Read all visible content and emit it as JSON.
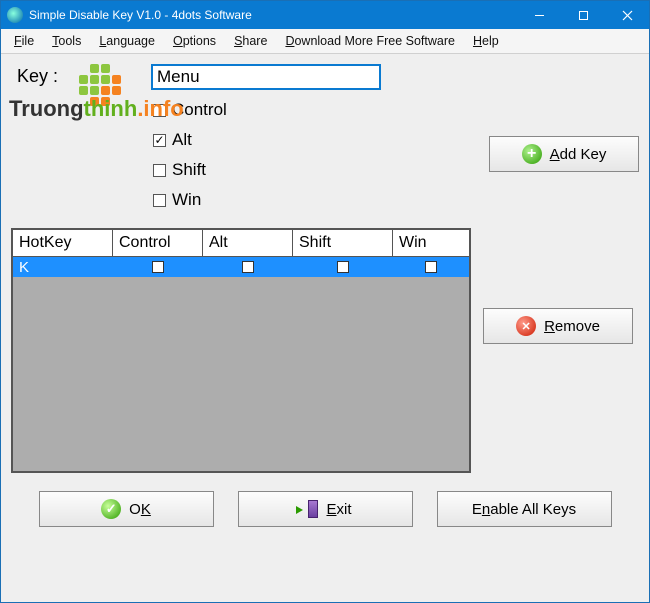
{
  "title": "Simple Disable Key V1.0 - 4dots Software",
  "menu": {
    "file": "File",
    "tools": "Tools",
    "language": "Language",
    "options": "Options",
    "share": "Share",
    "download": "Download More Free Software",
    "help": "Help"
  },
  "key_label": "Key :",
  "key_value": "Menu",
  "modifiers": {
    "control_label": "Control",
    "control_checked": false,
    "alt_label": "Alt",
    "alt_checked": true,
    "shift_label": "Shift",
    "shift_checked": false,
    "win_label": "Win",
    "win_checked": false
  },
  "buttons": {
    "add": "Add Key",
    "remove": "Remove",
    "ok": "OK",
    "exit": "Exit",
    "enable_all": "Enable All Keys"
  },
  "grid": {
    "headers": {
      "hotkey": "HotKey",
      "control": "Control",
      "alt": "Alt",
      "shift": "Shift",
      "win": "Win"
    },
    "rows": [
      {
        "hotkey": "K",
        "control": false,
        "alt": false,
        "shift": false,
        "win": false
      }
    ]
  },
  "watermark": {
    "a": "Truong",
    "b": "thinh",
    "c": ".info"
  }
}
